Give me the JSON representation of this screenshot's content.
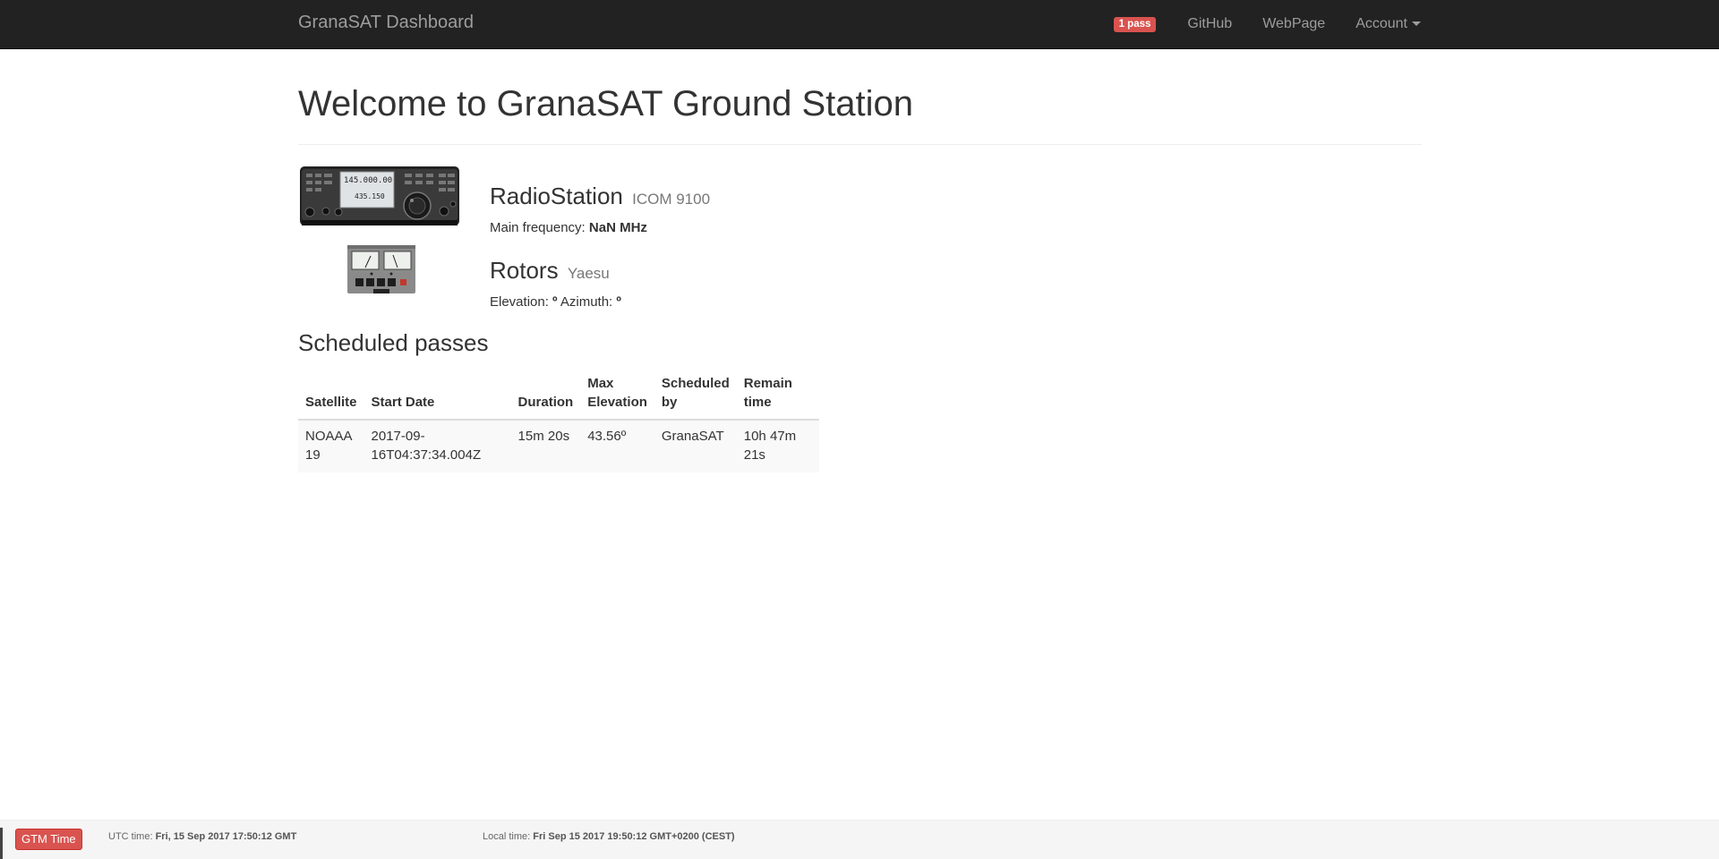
{
  "navbar": {
    "brand": "GranaSAT Dashboard",
    "pass_badge": "1 pass",
    "links": [
      "GitHub",
      "WebPage"
    ],
    "account": "Account",
    "bg_color": "#222222"
  },
  "page": {
    "title": "Welcome to GranaSAT Ground Station"
  },
  "radio": {
    "heading": "RadioStation",
    "model": "ICOM 9100",
    "freq_label": "Main frequency:",
    "freq_value": "NaN MHz",
    "display_main": "145.000.00",
    "display_sub": "435.150"
  },
  "rotors": {
    "heading": "Rotors",
    "model": "Yaesu",
    "elevation_label": "Elevation:",
    "elevation_value": "º",
    "azimuth_label": "Azimuth:",
    "azimuth_value": "º"
  },
  "passes": {
    "heading": "Scheduled passes",
    "columns": [
      [
        "Satellite"
      ],
      [
        "Start Date"
      ],
      [
        "Duration"
      ],
      [
        "Max",
        "Elevation"
      ],
      [
        "Scheduled",
        "by"
      ],
      [
        "Remain",
        "time"
      ]
    ],
    "rows": [
      [
        [
          "NOAAA",
          "19"
        ],
        [
          "2017-09-",
          "16T04:37:34.004Z"
        ],
        [
          "15m 20s"
        ],
        [
          "43.56º"
        ],
        [
          "GranaSAT"
        ],
        [
          "10h 47m",
          "21s"
        ]
      ]
    ]
  },
  "footer": {
    "badge": "GTM Time",
    "utc_label": "UTC time:",
    "utc_value": "Fri, 15 Sep 2017 17:50:12 GMT",
    "local_label": "Local time:",
    "local_value": "Fri Sep 15 2017 19:50:12 GMT+0200 (CEST)"
  },
  "colors": {
    "accent_red": "#d9534f",
    "muted": "#777777"
  }
}
